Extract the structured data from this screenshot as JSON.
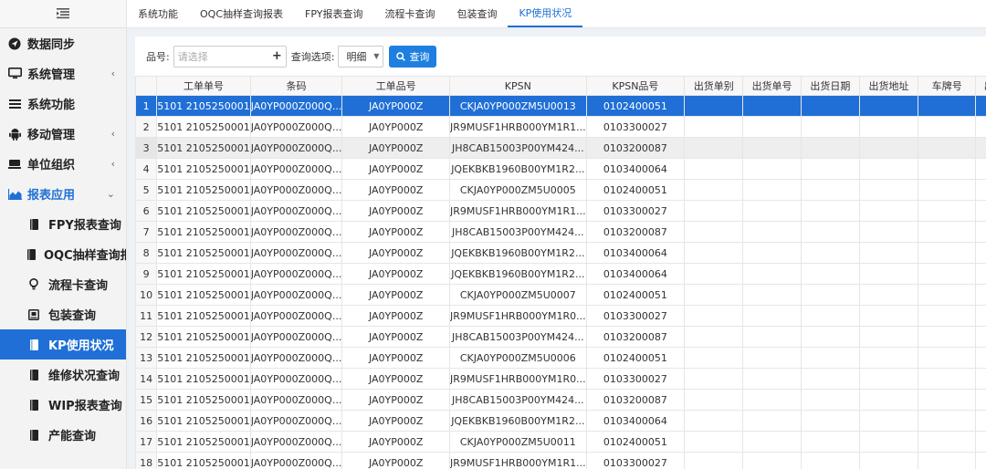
{
  "sidebar": {
    "items": [
      {
        "label": "数据同步"
      },
      {
        "label": "系统管理"
      },
      {
        "label": "系统功能"
      },
      {
        "label": "移动管理"
      },
      {
        "label": "单位组织"
      },
      {
        "label": "报表应用"
      }
    ],
    "sub_items": [
      {
        "label": "FPY报表查询"
      },
      {
        "label": "OQC抽样查询报"
      },
      {
        "label": "流程卡查询"
      },
      {
        "label": "包装查询"
      },
      {
        "label": "KP使用状况"
      },
      {
        "label": "维修状况查询"
      },
      {
        "label": "WIP报表查询"
      },
      {
        "label": "产能查询"
      }
    ]
  },
  "tabs": [
    {
      "label": "系统功能"
    },
    {
      "label": "OQC抽样查询报表"
    },
    {
      "label": "FPY报表查询"
    },
    {
      "label": "流程卡查询"
    },
    {
      "label": "包装查询"
    },
    {
      "label": "KP使用状况"
    }
  ],
  "search": {
    "part_label": "品号:",
    "part_placeholder": "请选择",
    "option_label": "查询选项:",
    "option_value": "明细",
    "query_button": "查询"
  },
  "table": {
    "columns": [
      "",
      "工单单号",
      "条码",
      "工单品号",
      "KPSN",
      "KPSN品号",
      "出货单别",
      "出货单号",
      "出货日期",
      "出货地址",
      "车牌号",
      "出"
    ],
    "rows": [
      [
        "1",
        "5101 2105250001",
        "JA0YP000Z000Q...",
        "JA0YP000Z",
        "CKJA0YP000ZM5U0013",
        "0102400051"
      ],
      [
        "2",
        "5101 2105250001",
        "JA0YP000Z000Q...",
        "JA0YP000Z",
        "JR9MUSF1HRB000YM1R1...",
        "0103300027"
      ],
      [
        "3",
        "5101 2105250001",
        "JA0YP000Z000Q...",
        "JA0YP000Z",
        "JH8CAB15003P00YM424...",
        "0103200087"
      ],
      [
        "4",
        "5101 2105250001",
        "JA0YP000Z000Q...",
        "JA0YP000Z",
        "JQEKBKB1960B00YM1R2...",
        "0103400064"
      ],
      [
        "5",
        "5101 2105250001",
        "JA0YP000Z000Q...",
        "JA0YP000Z",
        "CKJA0YP000ZM5U0005",
        "0102400051"
      ],
      [
        "6",
        "5101 2105250001",
        "JA0YP000Z000Q...",
        "JA0YP000Z",
        "JR9MUSF1HRB000YM1R1...",
        "0103300027"
      ],
      [
        "7",
        "5101 2105250001",
        "JA0YP000Z000Q...",
        "JA0YP000Z",
        "JH8CAB15003P00YM424...",
        "0103200087"
      ],
      [
        "8",
        "5101 2105250001",
        "JA0YP000Z000Q...",
        "JA0YP000Z",
        "JQEKBKB1960B00YM1R2...",
        "0103400064"
      ],
      [
        "9",
        "5101 2105250001",
        "JA0YP000Z000Q...",
        "JA0YP000Z",
        "JQEKBKB1960B00YM1R2...",
        "0103400064"
      ],
      [
        "10",
        "5101 2105250001",
        "JA0YP000Z000Q...",
        "JA0YP000Z",
        "CKJA0YP000ZM5U0007",
        "0102400051"
      ],
      [
        "11",
        "5101 2105250001",
        "JA0YP000Z000Q...",
        "JA0YP000Z",
        "JR9MUSF1HRB000YM1R0...",
        "0103300027"
      ],
      [
        "12",
        "5101 2105250001",
        "JA0YP000Z000Q...",
        "JA0YP000Z",
        "JH8CAB15003P00YM424...",
        "0103200087"
      ],
      [
        "13",
        "5101 2105250001",
        "JA0YP000Z000Q...",
        "JA0YP000Z",
        "CKJA0YP000ZM5U0006",
        "0102400051"
      ],
      [
        "14",
        "5101 2105250001",
        "JA0YP000Z000Q...",
        "JA0YP000Z",
        "JR9MUSF1HRB000YM1R0...",
        "0103300027"
      ],
      [
        "15",
        "5101 2105250001",
        "JA0YP000Z000Q...",
        "JA0YP000Z",
        "JH8CAB15003P00YM424...",
        "0103200087"
      ],
      [
        "16",
        "5101 2105250001",
        "JA0YP000Z000Q...",
        "JA0YP000Z",
        "JQEKBKB1960B00YM1R2...",
        "0103400064"
      ],
      [
        "17",
        "5101 2105250001",
        "JA0YP000Z000Q...",
        "JA0YP000Z",
        "CKJA0YP000ZM5U0011",
        "0102400051"
      ],
      [
        "18",
        "5101 2105250001",
        "JA0YP000Z000Q...",
        "JA0YP000Z",
        "JR9MUSF1HRB000YM1R1...",
        "0103300027"
      ]
    ]
  },
  "colors": {
    "accent": "#1f6fd6",
    "button": "#1f7fe0"
  }
}
